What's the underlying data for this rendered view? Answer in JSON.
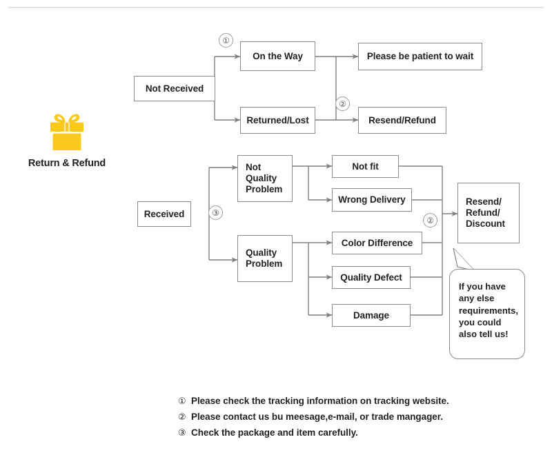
{
  "brand": {
    "icon": "gift-box-icon",
    "icon_color": "#FBC91B",
    "label": "Return & Refund"
  },
  "theme": {
    "box_border": "#8a8a8a",
    "line": "#7f7f7f",
    "text": "#231f20",
    "marker_border": "#9b9b9b",
    "divider": "#d9d9d9"
  },
  "flow": {
    "branch_not_received": {
      "root": "Not Received",
      "marker_1": "1",
      "marker_2": "2",
      "children": [
        {
          "label": "On the Way",
          "result": "Please be patient to wait"
        },
        {
          "label": "Returned/Lost",
          "result": "Resend/Refund"
        }
      ]
    },
    "branch_received": {
      "root": "Received",
      "marker_3": "3",
      "marker_2": "2",
      "groups": [
        {
          "label": "Not\nQuality\nProblem",
          "reasons": [
            "Not fit",
            "Wrong Delivery"
          ]
        },
        {
          "label": "Quality\nProblem",
          "reasons": [
            "Color Difference",
            "Quality Defect",
            "Damage"
          ]
        }
      ],
      "outcome": "Resend/\nRefund/\nDiscount"
    }
  },
  "bubble": {
    "text": "If you have\nany else\nrequirements,\nyou could\nalso tell us!"
  },
  "notes": [
    {
      "num": "①",
      "text": "Please check the tracking information on tracking website."
    },
    {
      "num": "②",
      "text": "Please contact us bu meesage,e-mail, or trade mangager."
    },
    {
      "num": "③",
      "text": "Check the package and item carefully."
    }
  ]
}
